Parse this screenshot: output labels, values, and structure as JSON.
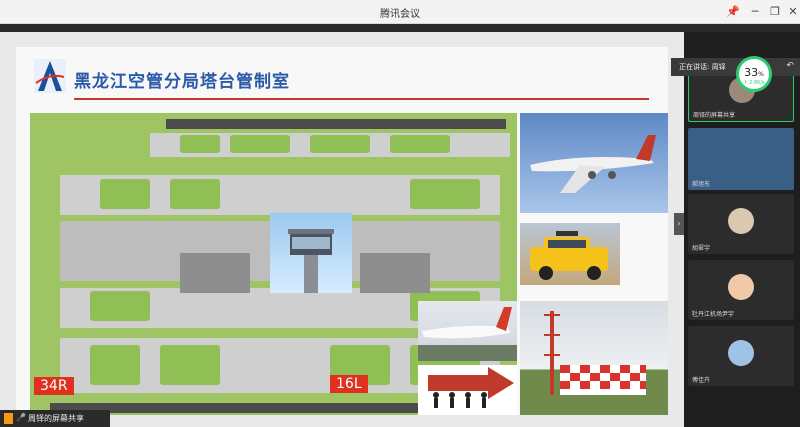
{
  "window": {
    "title": "腾讯会议",
    "pin": "📌",
    "minimize": "─",
    "maximize": "❐",
    "close": "✕"
  },
  "slide": {
    "title": "黑龙江空管分局塔台管制室",
    "runway_left": "34R",
    "runway_right": "16L"
  },
  "speaking": {
    "label": "正在讲话: 周铎",
    "percent": "33",
    "unit": "%",
    "speed": "↑ 2.8K/s"
  },
  "participants": [
    {
      "name": "周铎的屏幕共享"
    },
    {
      "name": "郝旭东"
    },
    {
      "name": "胡翠宇"
    },
    {
      "name": "牡丹江机场尹宇"
    },
    {
      "name": "傅佳卉"
    }
  ],
  "share_bar": {
    "label": "周铎的屏幕共享"
  },
  "colors": {
    "accent": "#2a5aa8",
    "red": "#e0301e",
    "speaking_ring": "#2ecc71"
  }
}
